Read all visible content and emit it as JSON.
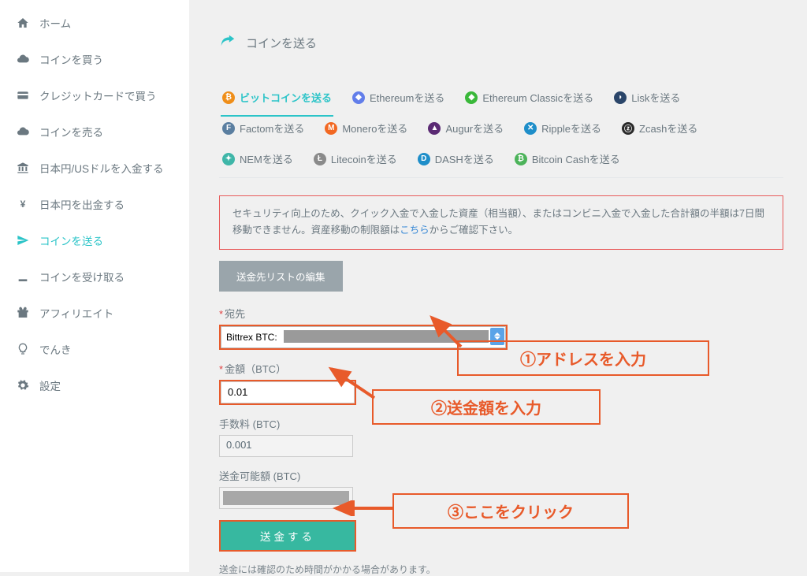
{
  "sidebar": {
    "items": [
      {
        "icon": "home",
        "label": "ホーム"
      },
      {
        "icon": "cloud-dn",
        "label": "コインを買う"
      },
      {
        "icon": "card",
        "label": "クレジットカードで買う"
      },
      {
        "icon": "cloud-up",
        "label": "コインを売る"
      },
      {
        "icon": "bank",
        "label": "日本円/USドルを入金する"
      },
      {
        "icon": "yen",
        "label": "日本円を出金する"
      },
      {
        "icon": "send",
        "label": "コインを送る",
        "active": true
      },
      {
        "icon": "download",
        "label": "コインを受け取る"
      },
      {
        "icon": "gift",
        "label": "アフィリエイト"
      },
      {
        "icon": "bulb",
        "label": "でんき"
      },
      {
        "icon": "gear",
        "label": "設定"
      }
    ]
  },
  "header": {
    "title": "コインを送る"
  },
  "tabs": [
    {
      "key": "btc",
      "label": "ビットコインを送る",
      "color": "#ef8e19",
      "sym": "₿",
      "active": true
    },
    {
      "key": "eth",
      "label": "Ethereumを送る",
      "color": "#627eea",
      "sym": "◆"
    },
    {
      "key": "etc",
      "label": "Ethereum Classicを送る",
      "color": "#3ab83a",
      "sym": "◆"
    },
    {
      "key": "lsk",
      "label": "Liskを送る",
      "color": "#2a4569",
      "sym": "◗"
    },
    {
      "key": "fct",
      "label": "Factomを送る",
      "color": "#5a7ea0",
      "sym": "F"
    },
    {
      "key": "xmr",
      "label": "Moneroを送る",
      "color": "#f26822",
      "sym": "M"
    },
    {
      "key": "rep",
      "label": "Augurを送る",
      "color": "#5b2a74",
      "sym": "▲"
    },
    {
      "key": "xrp",
      "label": "Rippleを送る",
      "color": "#1e8ec9",
      "sym": "✕"
    },
    {
      "key": "zec",
      "label": "Zcashを送る",
      "color": "#2a2a2a",
      "sym": "ⓩ"
    },
    {
      "key": "xem",
      "label": "NEMを送る",
      "color": "#3fb6a8",
      "sym": "✦"
    },
    {
      "key": "ltc",
      "label": "Litecoinを送る",
      "color": "#8a8a8a",
      "sym": "Ł"
    },
    {
      "key": "dash",
      "label": "DASHを送る",
      "color": "#1e8ec9",
      "sym": "D"
    },
    {
      "key": "bch",
      "label": "Bitcoin Cashを送る",
      "color": "#4cb35a",
      "sym": "₿"
    }
  ],
  "notice": {
    "text1": "セキュリティ向上のため、クイック入金で入金した資産（相当額）、またはコンビニ入金で入金した合計額の半額は7日間移動できません。資産移動の制限額は",
    "link": "こちら",
    "text2": "からご確認下さい。"
  },
  "list_edit_button": "送金先リストの編集",
  "form": {
    "dest_label": "宛先",
    "dest_value": "Bittrex BTC:",
    "amount_label": "金額（BTC）",
    "amount_value": "0.01",
    "fee_label": "手数料 (BTC)",
    "fee_value": "0.001",
    "available_label": "送金可能額 (BTC)",
    "send_button": "送金する",
    "required_mark": "*"
  },
  "footer_note": "送金には確認のため時間がかかる場合があります。",
  "annotations": {
    "a1": "①アドレスを入力",
    "a2": "②送金額を入力",
    "a3": "③ここをクリック"
  },
  "colors": {
    "accent": "#2cc4c8",
    "callout": "#e85a2a",
    "sendBtn": "#37b8a0"
  }
}
